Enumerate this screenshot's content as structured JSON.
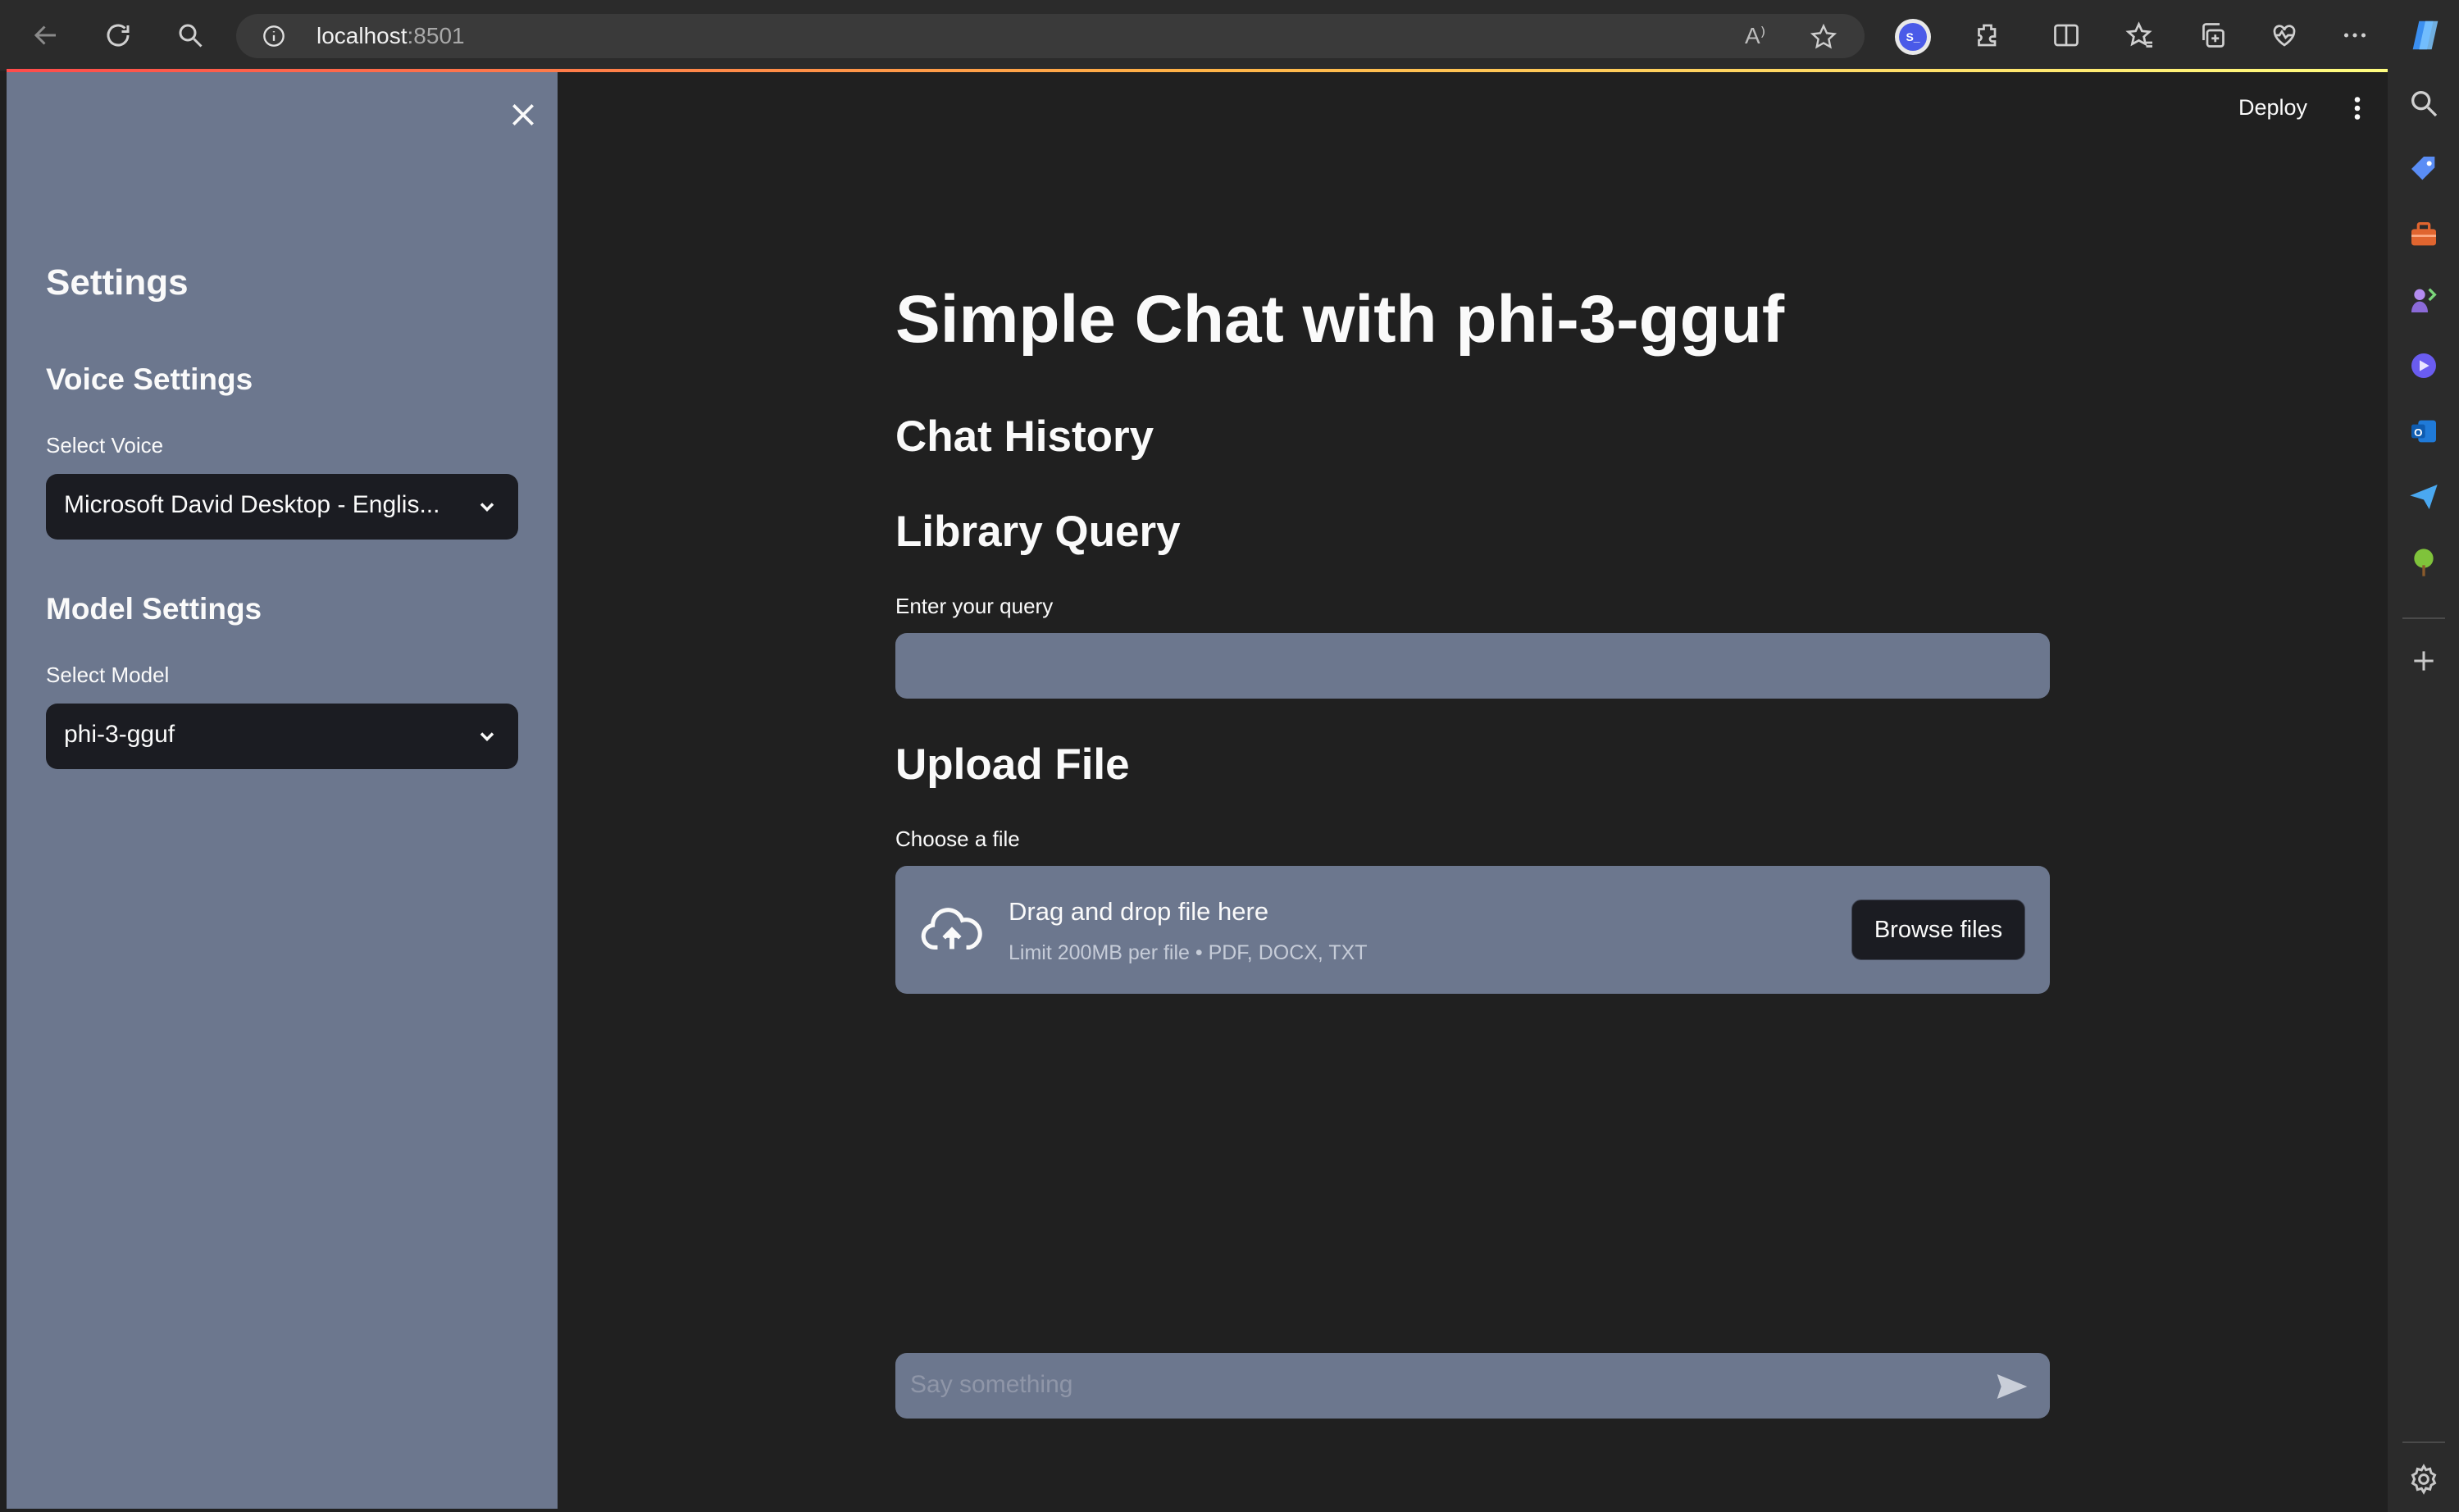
{
  "browser": {
    "url_host": "localhost",
    "url_port": ":8501",
    "read_aloud": "A⁾"
  },
  "header": {
    "deploy_label": "Deploy"
  },
  "sidebar": {
    "title": "Settings",
    "voice_section": "Voice Settings",
    "voice_label": "Select Voice",
    "voice_value": "Microsoft David Desktop - Englis...",
    "model_section": "Model Settings",
    "model_label": "Select Model",
    "model_value": "phi-3-gguf"
  },
  "main": {
    "title": "Simple Chat with phi-3-gguf",
    "chat_history": "Chat History",
    "library_query": "Library Query",
    "query_label": "Enter your query",
    "upload_heading": "Upload File",
    "upload_label": "Choose a file",
    "drop_title": "Drag and drop file here",
    "drop_limit": "Limit 200MB per file • PDF, DOCX, TXT",
    "browse_label": "Browse files",
    "chat_placeholder": "Say something"
  },
  "colors": {
    "sidebar_bg": "#6c778e",
    "main_bg": "#202020",
    "select_bg": "#1b1c22",
    "accent_gradient": [
      "#ff4b4b",
      "#ffb347",
      "#fffd80"
    ]
  },
  "icons": {
    "toolbar": [
      "back-icon",
      "refresh-icon",
      "search-icon",
      "info-icon",
      "read-aloud-icon",
      "favorite-star-icon",
      "profile-icon",
      "extensions-icon",
      "split-screen-icon",
      "favorites-icon",
      "collections-icon",
      "browser-essentials-icon",
      "more-icon",
      "copilot-icon"
    ],
    "edgebar": [
      "search-icon",
      "shopping-tag-icon",
      "tools-icon",
      "games-icon",
      "copilot-circle-icon",
      "outlook-icon",
      "send-icon",
      "tree-icon",
      "add-icon",
      "settings-gear-icon"
    ]
  }
}
